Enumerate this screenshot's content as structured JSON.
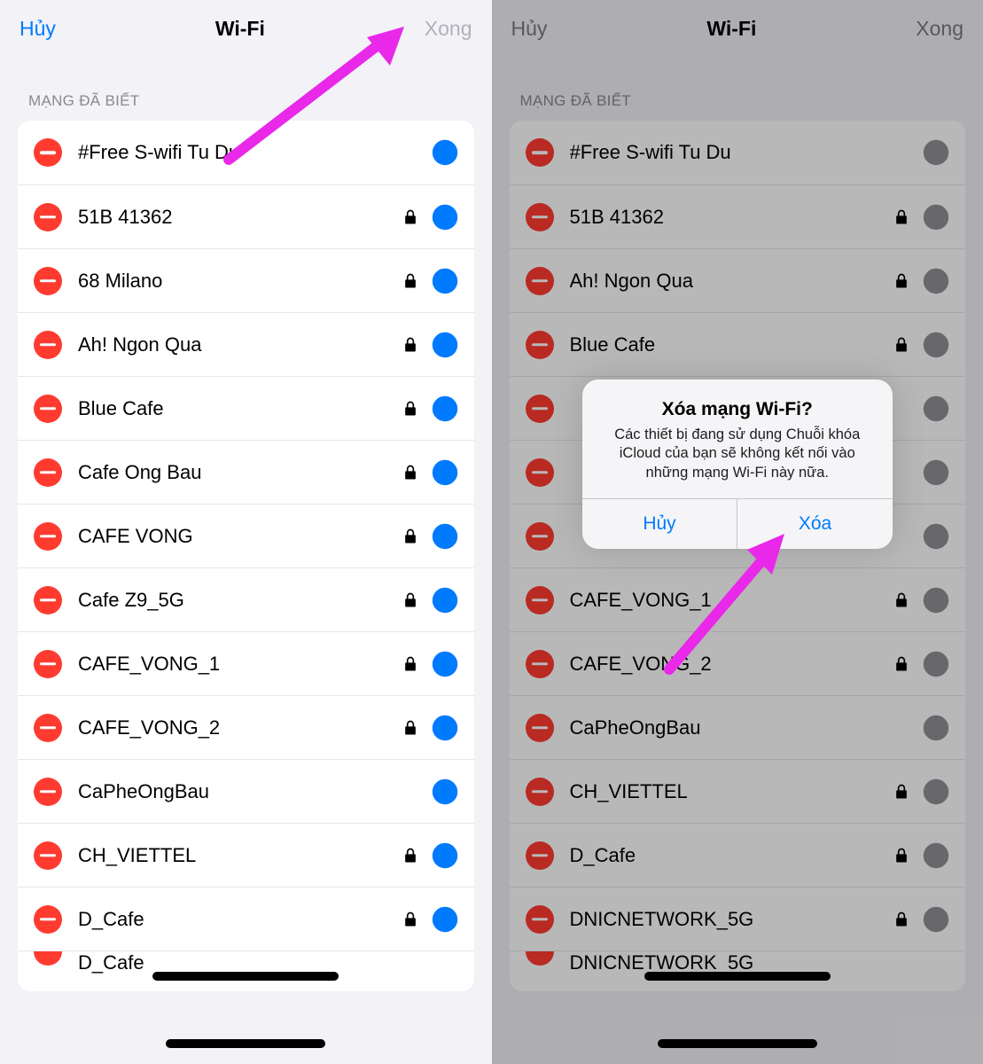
{
  "left": {
    "nav": {
      "cancel": "Hủy",
      "title": "Wi-Fi",
      "done": "Xong"
    },
    "section_header": "MẠNG ĐÃ BIẾT",
    "networks": [
      {
        "name": "#Free S-wifi Tu Du",
        "locked": false
      },
      {
        "name": "51B 41362",
        "locked": true
      },
      {
        "name": "68 Milano",
        "locked": true
      },
      {
        "name": "Ah! Ngon Qua",
        "locked": true
      },
      {
        "name": "Blue Cafe",
        "locked": true
      },
      {
        "name": "Cafe Ong Bau",
        "locked": true
      },
      {
        "name": "CAFE VONG",
        "locked": true
      },
      {
        "name": "Cafe Z9_5G",
        "locked": true
      },
      {
        "name": "CAFE_VONG_1",
        "locked": true
      },
      {
        "name": "CAFE_VONG_2",
        "locked": true
      },
      {
        "name": "CaPheOngBau",
        "locked": false
      },
      {
        "name": "CH_VIETTEL",
        "locked": true
      },
      {
        "name": "D_Cafe",
        "locked": true
      }
    ],
    "cut_row_name": "D_Cafe"
  },
  "right": {
    "nav": {
      "cancel": "Hủy",
      "title": "Wi-Fi",
      "done": "Xong"
    },
    "section_header": "MẠNG ĐÃ BIẾT",
    "networks": [
      {
        "name": "#Free S-wifi Tu Du",
        "locked": false
      },
      {
        "name": "51B 41362",
        "locked": true
      },
      {
        "name": "Ah! Ngon Qua",
        "locked": true
      },
      {
        "name": "Blue Cafe",
        "locked": true
      },
      {
        "name": "",
        "locked": false
      },
      {
        "name": "",
        "locked": false
      },
      {
        "name": "",
        "locked": false
      },
      {
        "name": "CAFE_VONG_1",
        "locked": true
      },
      {
        "name": "CAFE_VONG_2",
        "locked": true
      },
      {
        "name": "CaPheOngBau",
        "locked": false
      },
      {
        "name": "CH_VIETTEL",
        "locked": true
      },
      {
        "name": "D_Cafe",
        "locked": true
      },
      {
        "name": "DNICNETWORK_5G",
        "locked": true
      }
    ],
    "cut_row_name": "DNICNETWORK_5G",
    "alert": {
      "title": "Xóa mạng Wi-Fi?",
      "message": "Các thiết bị đang sử dụng Chuỗi khóa iCloud của bạn sẽ không kết nối vào những mạng Wi-Fi này nữa.",
      "cancel": "Hủy",
      "confirm": "Xóa"
    }
  },
  "icons": {
    "delete_minus": "delete-minus-icon",
    "lock": "lock-icon",
    "info": "info-icon"
  }
}
